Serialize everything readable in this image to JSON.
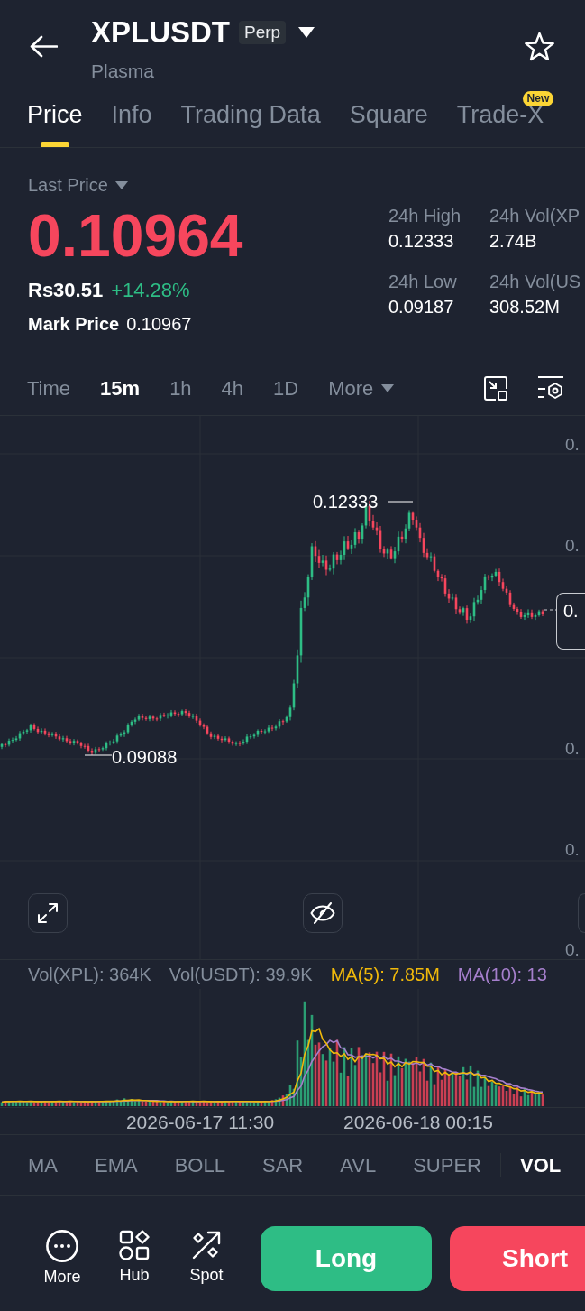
{
  "header": {
    "symbol": "XPLUSDT",
    "contract_type": "Perp",
    "name": "Plasma",
    "favorite": false
  },
  "tabs": [
    {
      "label": "Price",
      "selected": true
    },
    {
      "label": "Info",
      "selected": false
    },
    {
      "label": "Trading Data",
      "selected": false
    },
    {
      "label": "Square",
      "selected": false
    },
    {
      "label": "Trade-X",
      "selected": false,
      "badge": "New"
    }
  ],
  "price": {
    "label": "Last Price",
    "value": "0.10964",
    "rising": false,
    "fiat_value": "Rs30.51",
    "change": "+14.28%",
    "change_positive": true,
    "mark_label": "Mark Price",
    "mark_value": "0.10967"
  },
  "stats": [
    {
      "label": "24h High",
      "value": "0.12333"
    },
    {
      "label": "24h Vol(XP",
      "value": "2.74B"
    },
    {
      "label": "24h Low",
      "value": "0.09187"
    },
    {
      "label": "24h Vol(US",
      "value": "308.52M"
    }
  ],
  "intervals": [
    {
      "label": "Time",
      "kind": "option",
      "selected": false
    },
    {
      "label": "15m",
      "kind": "option",
      "selected": true
    },
    {
      "label": "1h",
      "kind": "option",
      "selected": false
    },
    {
      "label": "4h",
      "kind": "option",
      "selected": false
    },
    {
      "label": "1D",
      "kind": "option",
      "selected": false
    },
    {
      "label": "More",
      "kind": "menu",
      "selected": false
    }
  ],
  "chart": {
    "price_labels": [
      "0.",
      "0.",
      "0.",
      "0.",
      "0."
    ],
    "current_price": "0.",
    "high_marker": "0.12333",
    "low_marker": "0.09088"
  },
  "volume": {
    "legend": [
      {
        "label": "Vol(XPL): 364K",
        "kind": "volume",
        "color": "#848e9c"
      },
      {
        "label": "Vol(USDT): 39.9K",
        "kind": "volume",
        "color": "#848e9c"
      },
      {
        "label": "MA(5): 7.85M",
        "kind": "average",
        "color": "#f0b90b"
      },
      {
        "label": "MA(10): 13",
        "kind": "average",
        "color": "#a57fcc"
      }
    ],
    "time_labels": [
      "2026-06-17 11:30",
      "2026-06-18 00:15"
    ]
  },
  "indicators": {
    "main": [
      {
        "label": "MA",
        "selected": false
      },
      {
        "label": "EMA",
        "selected": false
      },
      {
        "label": "BOLL",
        "selected": false
      },
      {
        "label": "SAR",
        "selected": false
      },
      {
        "label": "AVL",
        "selected": false
      },
      {
        "label": "SUPER",
        "selected": false
      }
    ],
    "sub": [
      {
        "label": "VOL",
        "selected": true
      }
    ]
  },
  "actions": [
    {
      "label": "More",
      "kind": "more"
    },
    {
      "label": "Hub",
      "kind": "hub"
    },
    {
      "label": "Spot",
      "kind": "spot"
    }
  ],
  "trade_buttons": [
    {
      "label": "Long",
      "kind": "long"
    },
    {
      "label": "Short",
      "kind": "short"
    }
  ]
}
